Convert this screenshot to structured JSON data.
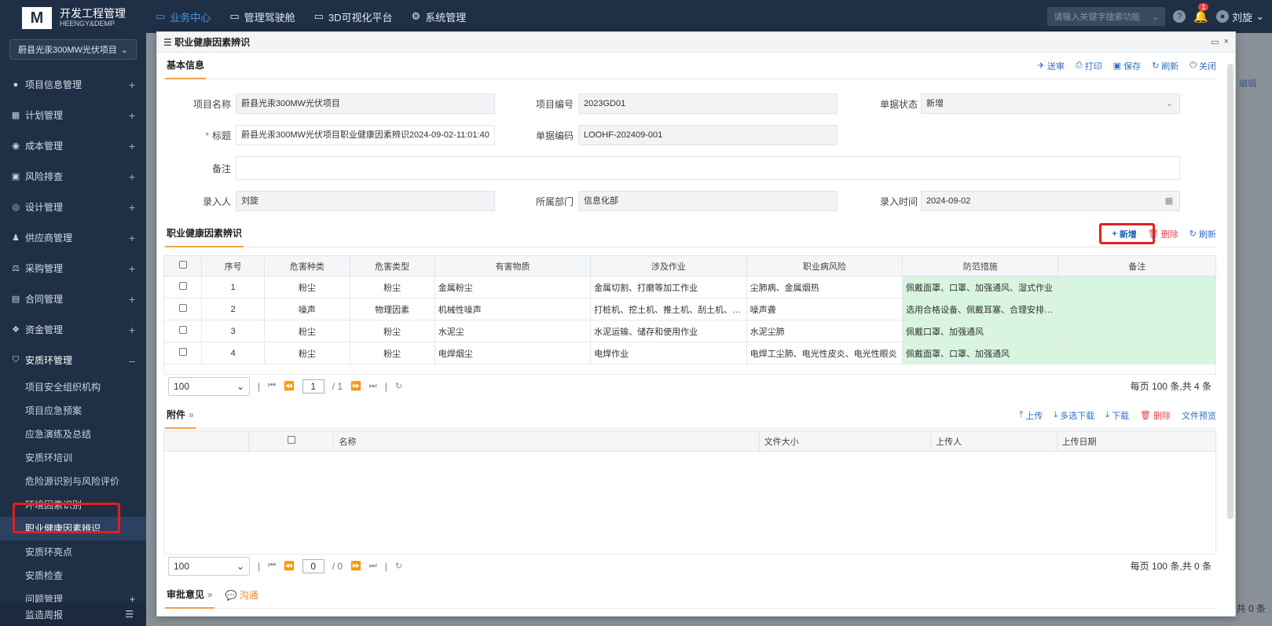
{
  "brand": {
    "logo": "M",
    "name": "开发工程管理",
    "sub": "HEENGY&DEMP"
  },
  "project_select": "蔚县光汞300MW光伏项目",
  "sidebar": {
    "items": [
      {
        "label": "项目信息管理",
        "icon": "●",
        "toggle": "+"
      },
      {
        "label": "计划管理",
        "icon": "▦",
        "toggle": "+"
      },
      {
        "label": "成本管理",
        "icon": "◉",
        "toggle": "+"
      },
      {
        "label": "风险排查",
        "icon": "▣",
        "toggle": "+"
      },
      {
        "label": "设计管理",
        "icon": "◎",
        "toggle": "+"
      },
      {
        "label": "供应商管理",
        "icon": "♟",
        "toggle": "+"
      },
      {
        "label": "采购管理",
        "icon": "⚖",
        "toggle": "+"
      },
      {
        "label": "合同管理",
        "icon": "▤",
        "toggle": "+"
      },
      {
        "label": "资金管理",
        "icon": "❖",
        "toggle": "+"
      },
      {
        "label": "安质环管理",
        "icon": "⛉",
        "toggle": "–"
      }
    ],
    "subitems": [
      "项目安全组织机构",
      "项目应急预案",
      "应急演练及总结",
      "安质环培训",
      "危险源识别与风险评价",
      "环境因素识别",
      "职业健康因素辨识",
      "安质环亮点",
      "安质检查"
    ],
    "problem": {
      "label": "问题管理",
      "toggle": "+"
    },
    "bottom": {
      "label": "监造周报",
      "icon": "☰"
    }
  },
  "topnav": {
    "tabs": [
      {
        "label": "业务中心",
        "icon": "▭"
      },
      {
        "label": "管理驾驶舱",
        "icon": "▭"
      },
      {
        "label": "3D可视化平台",
        "icon": "▭"
      },
      {
        "label": "系统管理",
        "icon": "⚙"
      }
    ],
    "search_placeholder": "请输入关键字搜索功能",
    "help": "?",
    "notify_count": "1",
    "user": "刘旋"
  },
  "background": {
    "edit": "✎ 编辑",
    "total": "共 0 条"
  },
  "modal": {
    "title": "职业健康因素辨识",
    "basic": {
      "title": "基本信息",
      "actions": [
        "送审",
        "打印",
        "保存",
        "刷新",
        "关闭"
      ],
      "fields": {
        "project_name_label": "项目名称",
        "project_name": "蔚县光汞300MW光伏项目",
        "project_code_label": "项目编号",
        "project_code": "2023GD01",
        "status_label": "单据状态",
        "status": "新增",
        "title_label": "标题",
        "title_value": "蔚县光汞300MW光伏项目职业健康因素辨识2024-09-02-11:01:40",
        "doc_code_label": "单据编码",
        "doc_code": "LOOHF-202409-001",
        "remark_label": "备注",
        "remark": "",
        "entry_person_label": "录入人",
        "entry_person": "刘旋",
        "dept_label": "所属部门",
        "dept": "信息化部",
        "entry_time_label": "录入时间",
        "entry_time": "2024-09-02"
      }
    },
    "factors": {
      "title": "职业健康因素辨识",
      "actions": {
        "add": "新增",
        "delete": "删除",
        "refresh": "刷新"
      },
      "columns": [
        "序号",
        "危害种类",
        "危害类型",
        "有害物质",
        "涉及作业",
        "职业病风险",
        "防范措施",
        "备注"
      ],
      "rows": [
        {
          "no": "1",
          "kind": "粉尘",
          "type": "粉尘",
          "substance": "金属粉尘",
          "work": "金属切割、打磨等加工作业",
          "risk": "尘肺病、金属烟热",
          "measure": "佩戴面罩、口罩、加强通风、湿式作业",
          "remark": ""
        },
        {
          "no": "2",
          "kind": "噪声",
          "type": "物理因素",
          "substance": "机械性噪声",
          "work": "打桩机、挖土机、推土机、刮土机、自卸...",
          "risk": "噪声聋",
          "measure": "选用合格设备、佩戴耳塞、合理安排作业...",
          "remark": ""
        },
        {
          "no": "3",
          "kind": "粉尘",
          "type": "粉尘",
          "substance": "水泥尘",
          "work": "水泥运输、储存和使用作业",
          "risk": "水泥尘肺",
          "measure": "佩戴口罩、加强通风",
          "remark": ""
        },
        {
          "no": "4",
          "kind": "粉尘",
          "type": "粉尘",
          "substance": "电焊烟尘",
          "work": "电焊作业",
          "risk": "电焊工尘肺、电光性皮炎、电光性眼炎",
          "measure": "佩戴面罩、口罩、加强通风",
          "remark": ""
        }
      ],
      "pager": {
        "size": "100",
        "page": "1",
        "pages": "/ 1",
        "total": "每页 100 条,共 4 条"
      }
    },
    "attachments": {
      "title": "附件",
      "actions": [
        "上传",
        "多选下载",
        "下载",
        "删除",
        "文件预览"
      ],
      "columns": [
        "名称",
        "文件大小",
        "上传人",
        "上传日期"
      ],
      "pager": {
        "size": "100",
        "page": "0",
        "pages": "/ 0",
        "total": "每页 100 条,共 0 条"
      }
    },
    "approval": {
      "title": "审批意见",
      "chat": "沟通"
    }
  },
  "colors": {
    "sidebar": "#1f3046",
    "accent": "#f0a14a",
    "link": "#2f6fc2",
    "danger": "#e04a4a",
    "green_cell": "#d8f5e0"
  }
}
